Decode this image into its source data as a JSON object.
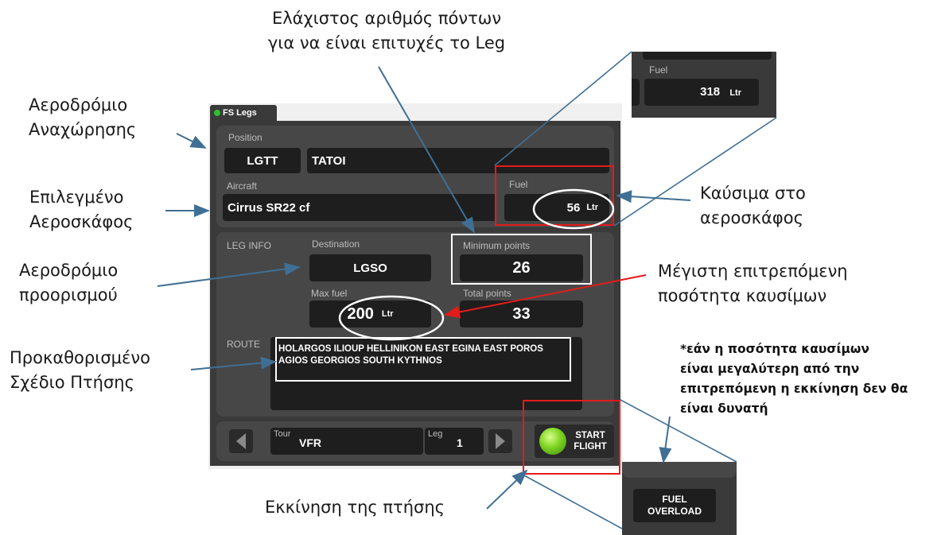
{
  "app": {
    "tab_label": "FS Legs",
    "position_label": "Position",
    "icao": "LGTT",
    "airport_name": "TATOI",
    "aircraft_label": "Aircraft",
    "aircraft": "Cirrus SR22 cf",
    "fuel_label": "Fuel",
    "fuel_value": "56",
    "fuel_unit": "Ltr",
    "leg_info_label": "LEG INFO",
    "destination_label": "Destination",
    "destination": "LGSO",
    "min_points_label": "Minimum points",
    "min_points": "26",
    "max_fuel_label": "Max fuel",
    "max_fuel_value": "200",
    "max_fuel_unit": "Ltr",
    "total_points_label": "Total points",
    "total_points": "33",
    "route_label": "ROUTE",
    "route_line1": "HOLARGOS ILIOUP HELLINIKON EAST EGINA EAST POROS",
    "route_line2": "AGIOS GEORGIOS SOUTH KYTHNOS",
    "tour_label": "Tour",
    "tour_value": "VFR",
    "leg_label": "Leg",
    "leg_value": "1",
    "start_line1": "START",
    "start_line2": "FLIGHT"
  },
  "inset_fuel": {
    "label": "Fuel",
    "value": "318",
    "unit": "Ltr"
  },
  "inset_overload": {
    "line1": "FUEL",
    "line2": "OVERLOAD"
  },
  "annotations": {
    "departure": [
      "Αεροδρόμιο",
      "Αναχώρησης"
    ],
    "aircraft": [
      "Επιλεγμένο",
      "Αεροσκάφος"
    ],
    "destination": [
      "Αεροδρόμιο",
      "προορισμού"
    ],
    "route": [
      "Προκαθορισμένο",
      "Σχέδιο Πτήσης"
    ],
    "min_points": [
      "Ελάχιστος αριθμός πόντων",
      "για να είναι επιτυχές το Leg"
    ],
    "fuel": [
      "Καύσιμα στο",
      "αεροσκάφος"
    ],
    "max_fuel": [
      "Μέγιστη επιτρεπόμενη",
      "ποσότητα καυσίμων"
    ],
    "note": [
      "*εάν η ποσότητα καυσίμων",
      "είναι μεγαλύτερη  από την",
      "επιτρεπόμενη η εκκίνηση δεν θα",
      "είναι δυνατή"
    ],
    "start": "Εκκίνηση της πτήσης"
  },
  "colors": {
    "highlight_red": "#e41b1b",
    "arrow_blue": "#3f6f94",
    "lamp_green": "#7ed321"
  }
}
